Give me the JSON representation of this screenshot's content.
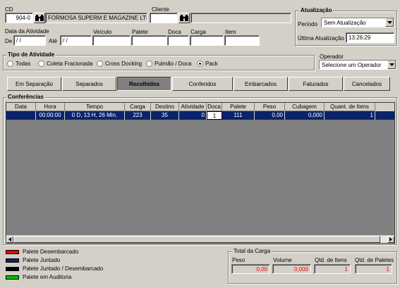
{
  "filters": {
    "cd_label": "CD",
    "cd_value": "904-0",
    "cd_name": "FORMOSA SUPERM E MAGAZINE LTDA",
    "cliente_label": "Cliente",
    "cliente_value": "",
    "cliente_name": "",
    "data_atividade_label": "Data da Atividade",
    "de_label": "De",
    "de_value": " / /",
    "ate_label": "Até",
    "ate_value": " / /",
    "veiculo_label": "Veículo",
    "palete_label": "Palete",
    "doca_label": "Doca",
    "carga_label": "Carga",
    "item_label": "Item"
  },
  "atualizacao": {
    "title": "Atualização",
    "periodo_label": "Período",
    "periodo_value": "Sem Atualização",
    "ultima_label": "Última Atualização",
    "ultima_value": "13:26:29"
  },
  "tipo_atividade": {
    "title": "Tipo de Atividade",
    "options": [
      "Todas",
      "Coleta Fracionada",
      "Cross Docking",
      "Pulmão / Doca",
      "Pack"
    ],
    "selected_index": 4
  },
  "operador": {
    "label": "Operador",
    "value": "Selecione um Operador"
  },
  "tabs": [
    "Em Separação",
    "Separados",
    "Recolhidos",
    "Conferidos",
    "Embarcados",
    "Faturados",
    "Cancelados"
  ],
  "active_tab_index": 2,
  "conferencias": {
    "title": "Conferências",
    "columns": [
      "Data",
      "Hora",
      "Tempo",
      "Carga",
      "Destino",
      "Atividade",
      "Doca",
      "Palete",
      "Peso",
      "Cubagem",
      "Quant. de Itens"
    ],
    "rows": [
      [
        "",
        "00:00:00",
        "0 D, 13 H, 26 Min.",
        "223",
        "35",
        "0",
        "1",
        "111",
        "0,00",
        "0,000",
        "1"
      ]
    ]
  },
  "legend": [
    {
      "label": "Palete Desembarcado",
      "color": "#ff0000"
    },
    {
      "label": "Palete Juntado",
      "color": "#0a246a"
    },
    {
      "label": "Palete Juntado / Desembarcado",
      "color": "#000000"
    },
    {
      "label": "Palete em Auditoria",
      "color": "#00c000"
    }
  ],
  "total_carga": {
    "title": "Total da Carga",
    "peso_label": "Peso",
    "peso_value": "0,00",
    "volume_label": "Volume",
    "volume_value": "0,000",
    "itens_label": "Qtd. de Itens",
    "itens_value": "1",
    "paletes_label": "Qtd. de Paletes",
    "paletes_value": "1",
    "value_color": "#ff0000"
  }
}
